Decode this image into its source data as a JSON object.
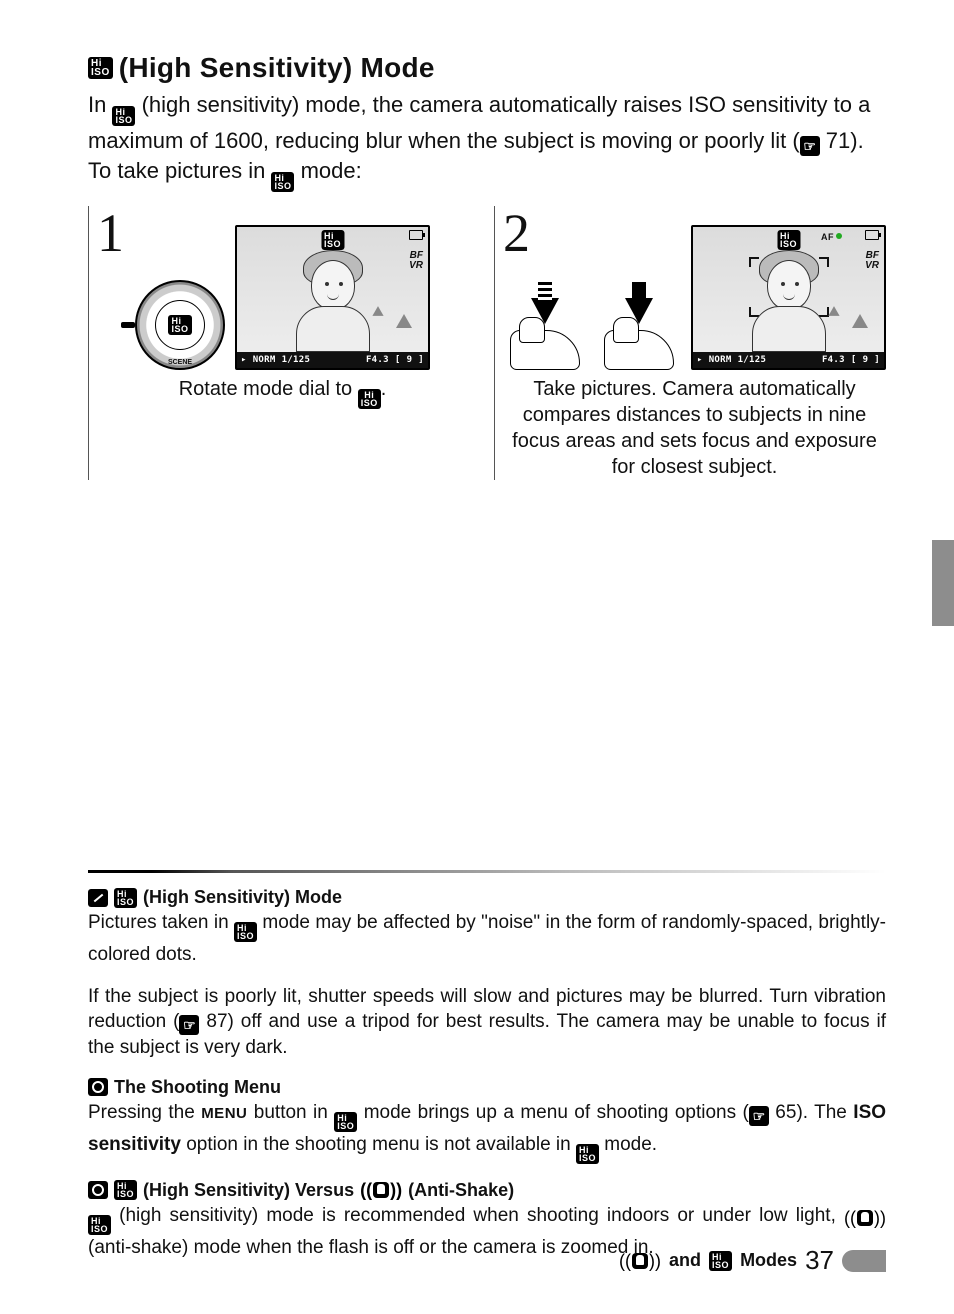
{
  "heading": "(High Sensitivity) Mode",
  "intro_parts": {
    "a": "In ",
    "b": " (high sensitivity) mode, the camera automatically raises ISO sensitivity to a maximum of 1600, reducing blur when the subject is moving or poorly lit (",
    "ref1": "71",
    "c": "). To take pictures in ",
    "d": " mode:"
  },
  "steps": [
    {
      "num": "1",
      "caption_a": "Rotate mode dial to ",
      "caption_b": "."
    },
    {
      "num": "2",
      "caption": "Take pictures.  Camera automatically compares distances to subjects in nine focus areas and sets focus and exposure for closest subject."
    }
  ],
  "lcd": {
    "iso_top": "Hi",
    "iso_bot": "ISO",
    "af": "AF",
    "vr1": "BF",
    "vr2": "VR",
    "bar_norm": "NORM",
    "bar_shutter": "1/125",
    "bar_f": "F4.3",
    "bar_br1": "[",
    "bar_count": "9",
    "bar_br2": "]",
    "scene": "SCENE"
  },
  "notes": {
    "n1_title": "(High Sensitivity) Mode",
    "n1_p1a": "Pictures taken in ",
    "n1_p1b": " mode may be affected by \"noise\" in the form of randomly-spaced, brightly-colored dots.",
    "n1_p2a": "If the subject is poorly lit, shutter speeds will slow and pictures may be blurred.  Turn vibration reduction (",
    "n1_ref": "87",
    "n1_p2b": ") off and use a tripod for best results.  The camera may be unable to focus if the subject is very dark.",
    "n2_title": "The Shooting Menu",
    "n2_a": "Pressing the ",
    "n2_menu": "MENU",
    "n2_b": " button in ",
    "n2_c": " mode brings up a menu of shooting options (",
    "n2_ref": "65",
    "n2_d": ").  The ",
    "n2_bold": "ISO sensitivity",
    "n2_e": " option in the shooting menu is not available in ",
    "n2_f": " mode.",
    "n3_title_a": "(High Sensitivity) Versus ",
    "n3_title_b": "(Anti-Shake)",
    "n3_a": " (high sensitivity) mode is recommended when shooting indoors or under low light, ",
    "n3_b": " (anti-shake) mode when the flash is off or the camera is zoomed in."
  },
  "footer": {
    "label_a": "and",
    "label_b": "Modes",
    "page": "37"
  }
}
